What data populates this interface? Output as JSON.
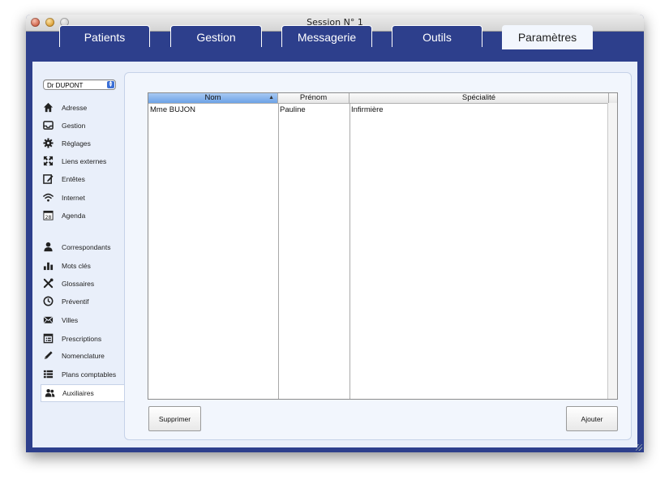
{
  "window": {
    "title": "Session N° 1"
  },
  "tabs": [
    {
      "label": "Patients"
    },
    {
      "label": "Gestion"
    },
    {
      "label": "Messagerie"
    },
    {
      "label": "Outils"
    },
    {
      "label": "Paramètres"
    }
  ],
  "doctor_select": {
    "value": "Dr DUPONT"
  },
  "sidebar": {
    "items": [
      {
        "label": "Adresse",
        "icon": "home-icon"
      },
      {
        "label": "Gestion",
        "icon": "inbox-icon"
      },
      {
        "label": "Réglages",
        "icon": "gear-icon"
      },
      {
        "label": "Liens externes",
        "icon": "expand-icon"
      },
      {
        "label": "Entêtes",
        "icon": "edit-icon"
      },
      {
        "label": "Internet",
        "icon": "wifi-icon"
      },
      {
        "label": "Agenda",
        "icon": "calendar-icon",
        "icon_text": "28"
      },
      {
        "label": "Correspondants",
        "icon": "person-icon"
      },
      {
        "label": "Mots clés",
        "icon": "bar-chart-icon"
      },
      {
        "label": "Glossaires",
        "icon": "tools-icon"
      },
      {
        "label": "Préventif",
        "icon": "clock-icon"
      },
      {
        "label": "Villes",
        "icon": "mail-icon"
      },
      {
        "label": "Prescriptions",
        "icon": "list-doc-icon"
      },
      {
        "label": "Nomenclature",
        "icon": "pen-icon"
      },
      {
        "label": "Plans comptables",
        "icon": "list-icon"
      },
      {
        "label": "Auxiliaires",
        "icon": "people-icon"
      }
    ]
  },
  "table": {
    "columns": [
      {
        "label": "Nom",
        "sorted": "ascending"
      },
      {
        "label": "Prénom"
      },
      {
        "label": "Spécialité"
      }
    ],
    "rows": [
      [
        "Mme BUJON",
        "Pauline",
        "Infirmière"
      ]
    ]
  },
  "buttons": {
    "delete_label": "Supprimer",
    "add_label": "Ajouter"
  },
  "colors": {
    "window_bg": "#2d3f8c",
    "content_bg": "#e9effa",
    "sort_header": "#6da2e6"
  }
}
